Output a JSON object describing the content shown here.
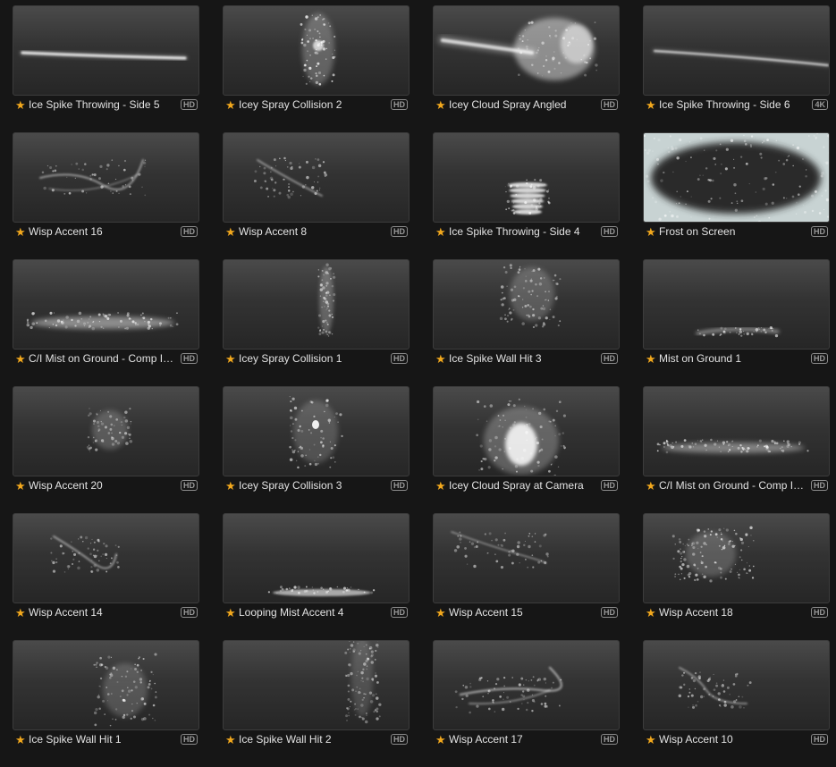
{
  "effects": [
    {
      "title": "Ice Spike Throwing - Side 5",
      "badge": "HD",
      "fx": "spike"
    },
    {
      "title": "Icey Spray Collision 2",
      "badge": "HD",
      "fx": "burst"
    },
    {
      "title": "Icey Cloud Spray Angled",
      "badge": "HD",
      "fx": "cloud"
    },
    {
      "title": "Ice Spike Throwing - Side 6",
      "badge": "4K",
      "fx": "spike2"
    },
    {
      "title": "Wisp Accent 16",
      "badge": "HD",
      "fx": "wisp"
    },
    {
      "title": "Wisp Accent 8",
      "badge": "HD",
      "fx": "wispdiag"
    },
    {
      "title": "Ice Spike Throwing - Side 4",
      "badge": "HD",
      "fx": "stack"
    },
    {
      "title": "Frost on Screen",
      "badge": "HD",
      "fx": "frost"
    },
    {
      "title": "C/I Mist on Ground - Comp In...",
      "badge": "HD",
      "fx": "groundmist"
    },
    {
      "title": "Icey Spray Collision 1",
      "badge": "HD",
      "fx": "column"
    },
    {
      "title": "Ice Spike Wall Hit 3",
      "badge": "HD",
      "fx": "burstup"
    },
    {
      "title": "Mist on Ground 1",
      "badge": "HD",
      "fx": "lowmist"
    },
    {
      "title": "Wisp Accent 20",
      "badge": "HD",
      "fx": "smallburst"
    },
    {
      "title": "Icey Spray Collision 3",
      "badge": "HD",
      "fx": "burstdot"
    },
    {
      "title": "Icey Cloud Spray at Camera",
      "badge": "HD",
      "fx": "brightcloud"
    },
    {
      "title": "C/I Mist on Ground - Comp In...",
      "badge": "HD",
      "fx": "groundmist2"
    },
    {
      "title": "Wisp Accent 14",
      "badge": "HD",
      "fx": "wisp2"
    },
    {
      "title": "Looping Mist Accent 4",
      "badge": "HD",
      "fx": "flatmist"
    },
    {
      "title": "Wisp Accent 15",
      "badge": "HD",
      "fx": "wispdiag2"
    },
    {
      "title": "Wisp Accent 18",
      "badge": "HD",
      "fx": "cluster"
    },
    {
      "title": "Ice Spike Wall Hit 1",
      "badge": "HD",
      "fx": "scatter"
    },
    {
      "title": "Ice Spike Wall Hit 2",
      "badge": "HD",
      "fx": "rain"
    },
    {
      "title": "Wisp Accent 17",
      "badge": "HD",
      "fx": "swirl"
    },
    {
      "title": "Wisp Accent 10",
      "badge": "HD",
      "fx": "curl"
    }
  ],
  "icons": {
    "favorite": "star-icon"
  },
  "colors": {
    "star": "#f2a81d",
    "background": "#161616",
    "text": "#e2e2e2"
  }
}
